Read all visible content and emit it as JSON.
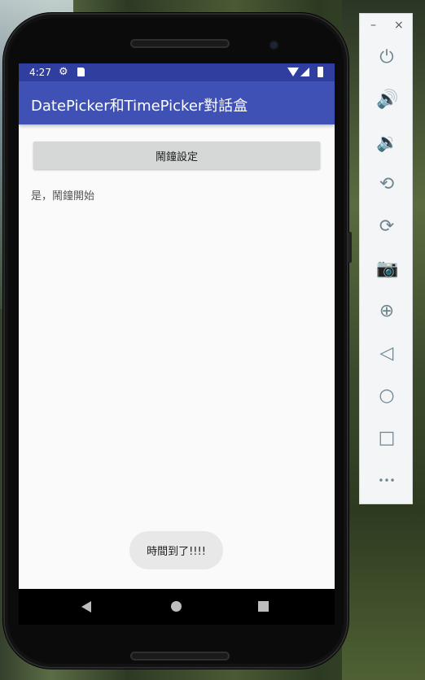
{
  "status_bar": {
    "time": "4:27"
  },
  "app_bar": {
    "title": "DatePicker和TimePicker對話盒"
  },
  "main": {
    "alarm_button_label": "鬧鐘設定",
    "status_text": "是，鬧鐘開始"
  },
  "toast": {
    "text": "時間到了!!!!"
  },
  "emulator_panel": {
    "window_controls": [
      "–",
      "×"
    ],
    "tools": [
      {
        "name": "power-icon",
        "glyph": "⏻"
      },
      {
        "name": "volume-up-icon",
        "glyph": "🔊"
      },
      {
        "name": "volume-down-icon",
        "glyph": "🔉"
      },
      {
        "name": "rotate-left-icon",
        "glyph": "⟲"
      },
      {
        "name": "rotate-right-icon",
        "glyph": "⟳"
      },
      {
        "name": "camera-icon",
        "glyph": "📷"
      },
      {
        "name": "zoom-icon",
        "glyph": "⊕"
      },
      {
        "name": "back-icon",
        "glyph": "◁"
      },
      {
        "name": "home-icon",
        "glyph": "○"
      },
      {
        "name": "overview-icon",
        "glyph": "□"
      },
      {
        "name": "more-icon",
        "glyph": "•••"
      }
    ]
  },
  "colors": {
    "status_bar": "#303f9f",
    "app_bar": "#3f51b5",
    "button": "#d6d7d7",
    "toast": "#e8e8e8"
  }
}
